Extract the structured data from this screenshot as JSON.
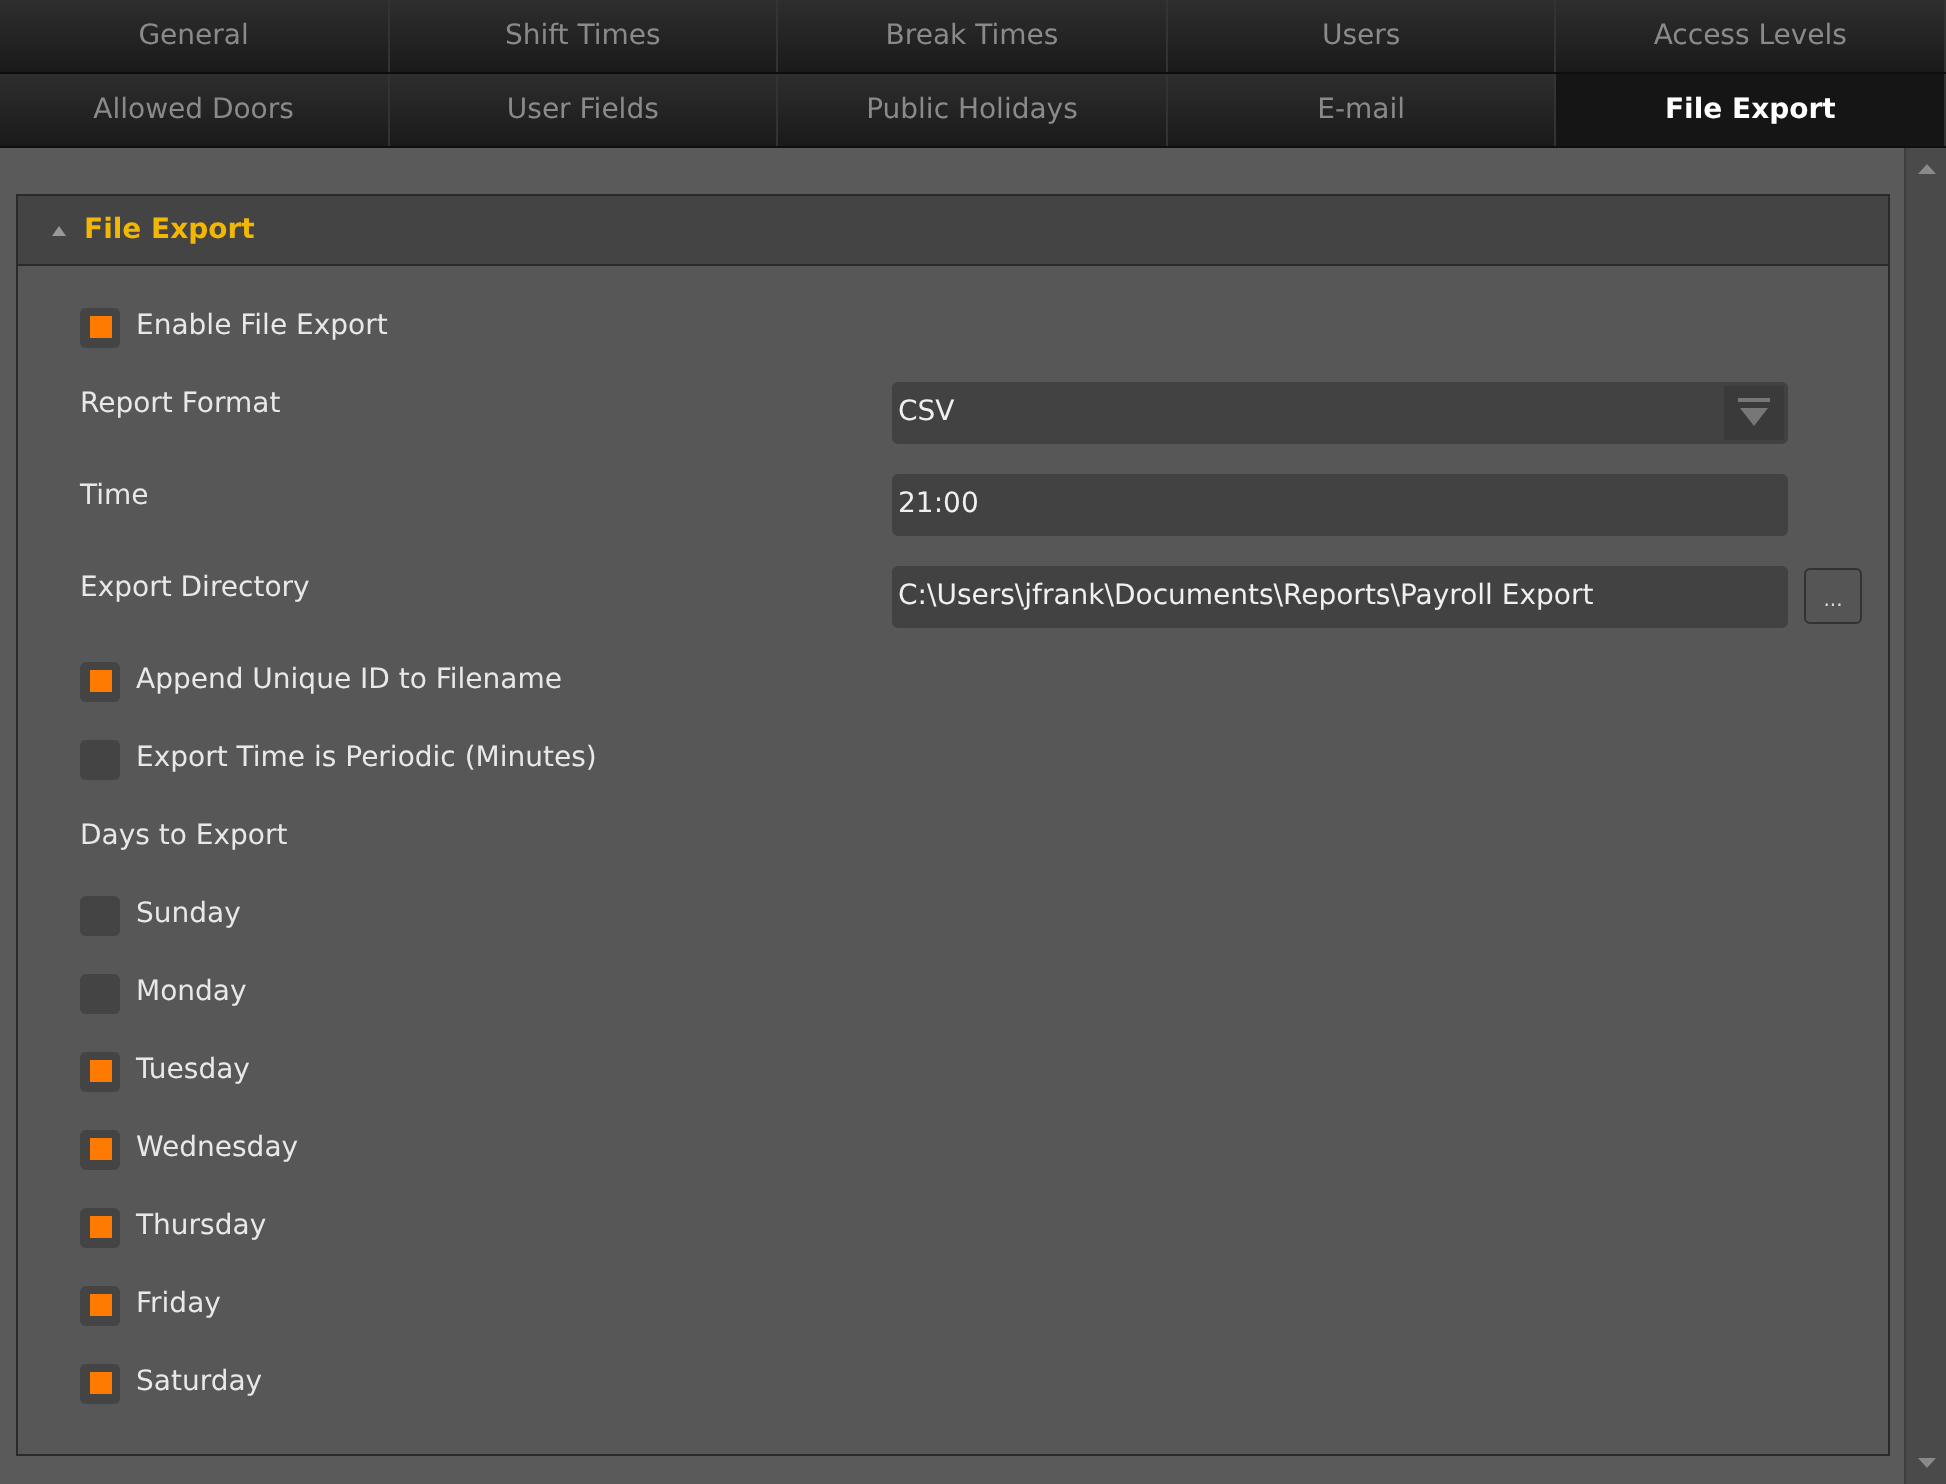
{
  "tab_rows": [
    [
      {
        "label": "General",
        "selected": false
      },
      {
        "label": "Shift Times",
        "selected": false
      },
      {
        "label": "Break Times",
        "selected": false
      },
      {
        "label": "Users",
        "selected": false
      },
      {
        "label": "Access Levels",
        "selected": false
      }
    ],
    [
      {
        "label": "Allowed Doors",
        "selected": false
      },
      {
        "label": "User Fields",
        "selected": false
      },
      {
        "label": "Public Holidays",
        "selected": false
      },
      {
        "label": "E-mail",
        "selected": false
      },
      {
        "label": "File Export",
        "selected": true
      }
    ]
  ],
  "section": {
    "title": "File Export",
    "expanded": true,
    "items": [
      {
        "kind": "checkbox",
        "label": "Enable File Export",
        "checked": true
      },
      {
        "kind": "dropdown",
        "label": "Report Format",
        "value": "CSV"
      },
      {
        "kind": "text",
        "label": "Time",
        "value": "21:00"
      },
      {
        "kind": "browse",
        "label": "Export Directory",
        "value": "C:\\Users\\jfrank\\Documents\\Reports\\Payroll Export",
        "button": "..."
      },
      {
        "kind": "checkbox",
        "label": "Append Unique ID to Filename",
        "checked": true
      },
      {
        "kind": "checkbox",
        "label": "Export Time is Periodic (Minutes)",
        "checked": false
      },
      {
        "kind": "heading",
        "label": "Days to Export"
      },
      {
        "kind": "checkbox",
        "label": "Sunday",
        "checked": false
      },
      {
        "kind": "checkbox",
        "label": "Monday",
        "checked": false
      },
      {
        "kind": "checkbox",
        "label": "Tuesday",
        "checked": true
      },
      {
        "kind": "checkbox",
        "label": "Wednesday",
        "checked": true
      },
      {
        "kind": "checkbox",
        "label": "Thursday",
        "checked": true
      },
      {
        "kind": "checkbox",
        "label": "Friday",
        "checked": true
      },
      {
        "kind": "checkbox",
        "label": "Saturday",
        "checked": true
      }
    ]
  }
}
